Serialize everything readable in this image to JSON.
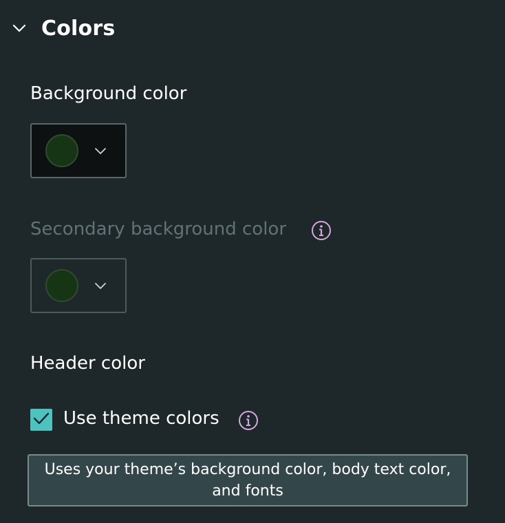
{
  "section": {
    "title": "Colors",
    "expanded": true,
    "chevron_icon": "chevron-down-icon"
  },
  "background_color": {
    "label": "Background color",
    "swatch_color": "#163514",
    "control_bg": "#0d1112",
    "caret_icon": "chevron-down-icon"
  },
  "secondary_background_color": {
    "label": "Secondary background color",
    "disabled": true,
    "swatch_color": "#163514",
    "caret_icon": "chevron-down-icon",
    "info_icon": "info-icon"
  },
  "header_color": {
    "label": "Header color",
    "use_theme_colors": {
      "label": "Use theme colors",
      "checked": true,
      "info_icon": "info-icon"
    }
  },
  "tooltip": {
    "text": "Uses your theme’s background color, body text color, and fonts"
  },
  "colors": {
    "panel_bg": "#1e2729",
    "text": "#ffffff",
    "disabled_text": "#5f7476",
    "checkbox_fill": "#4cc3bf",
    "info_icon": "#d5a8dc",
    "tooltip_bg": "#33474b"
  }
}
